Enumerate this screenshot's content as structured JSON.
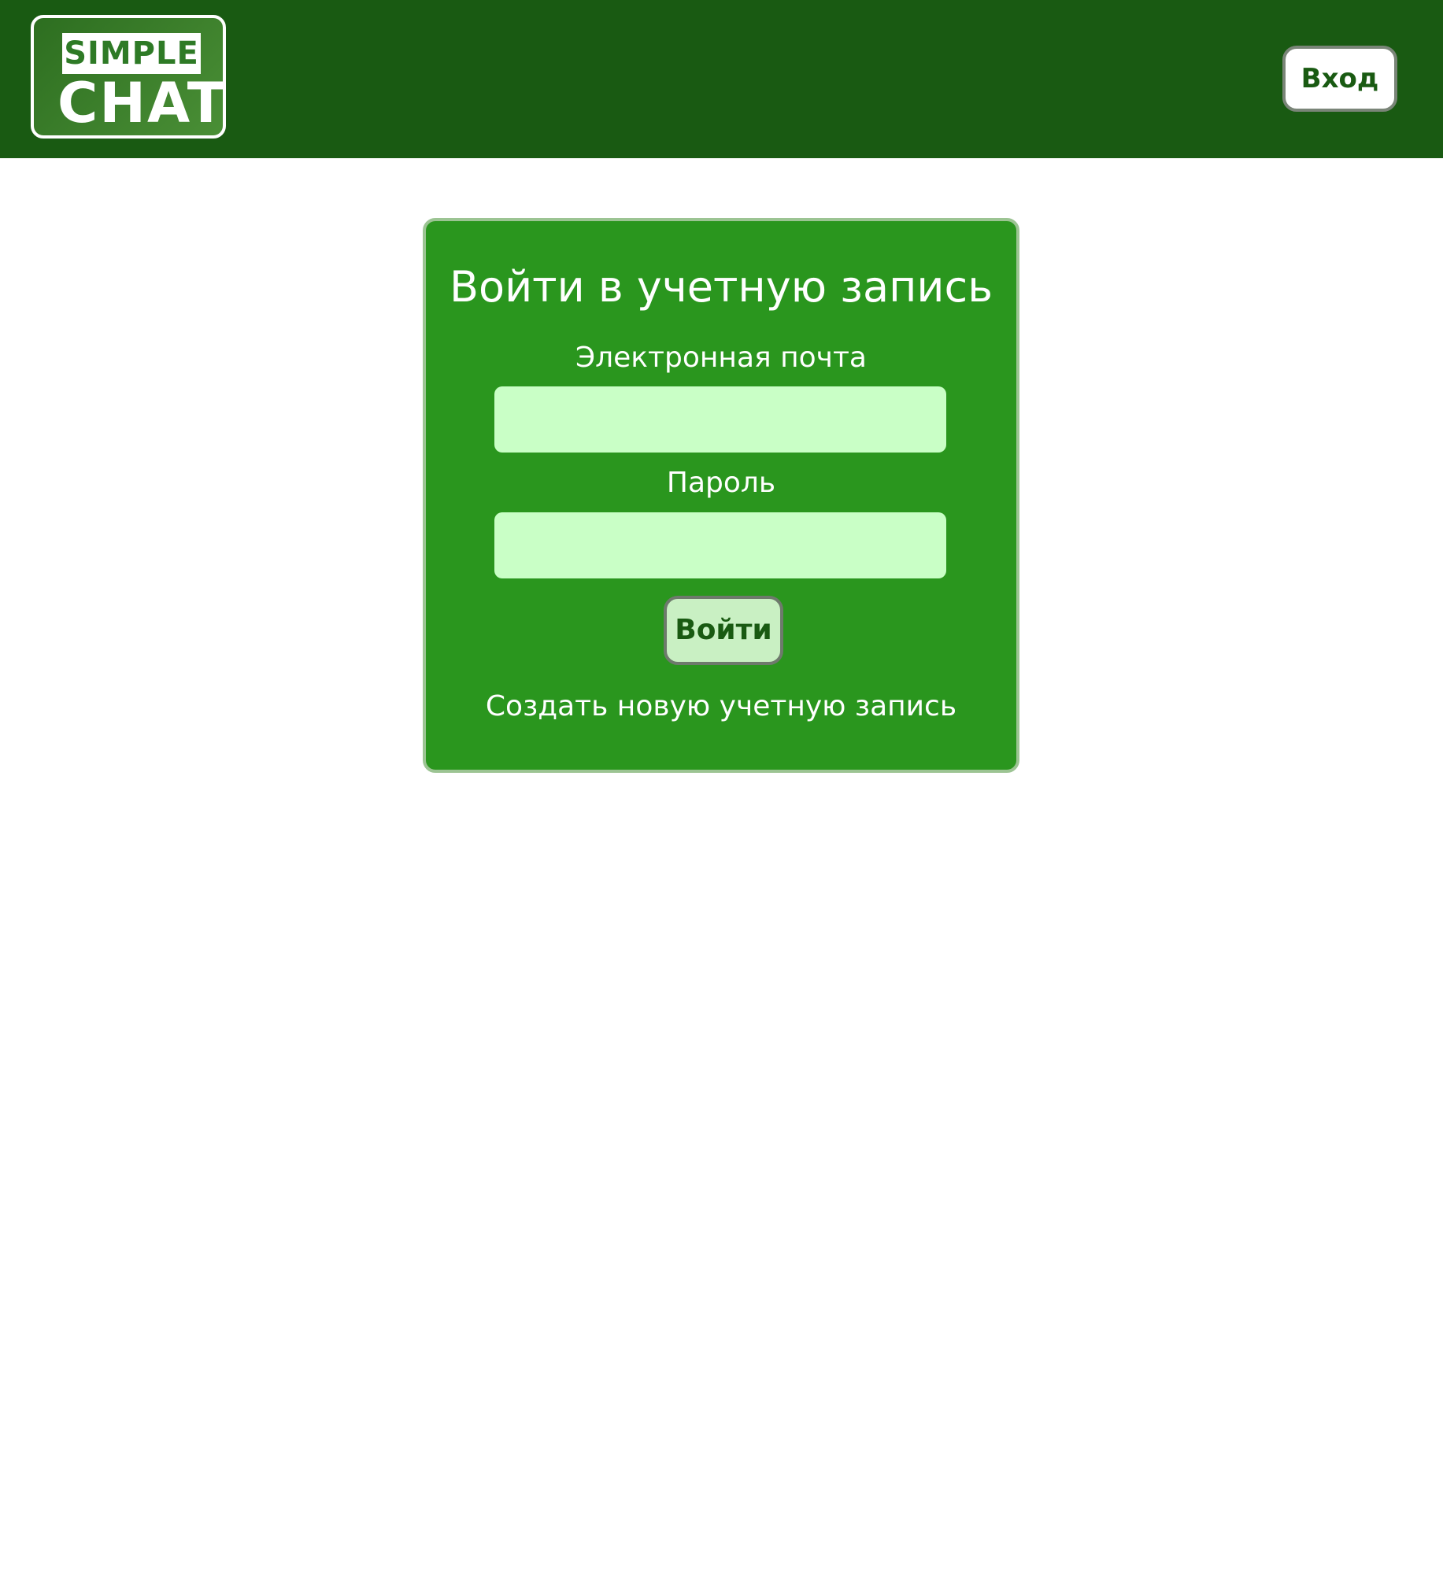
{
  "header": {
    "logo": {
      "line1": "SIMPLE",
      "line2": "CHAT"
    },
    "login_button_label": "Вход"
  },
  "login_form": {
    "title": "Войти в учетную запись",
    "email_label": "Электронная почта",
    "email_value": "",
    "password_label": "Пароль",
    "password_value": "",
    "submit_label": "Войти",
    "register_link": "Создать новую учетную запись"
  },
  "colors": {
    "header_bg": "#195a12",
    "card_bg": "#2a961e",
    "input_bg": "#c9ffc6",
    "accent_text": "#195a12"
  }
}
